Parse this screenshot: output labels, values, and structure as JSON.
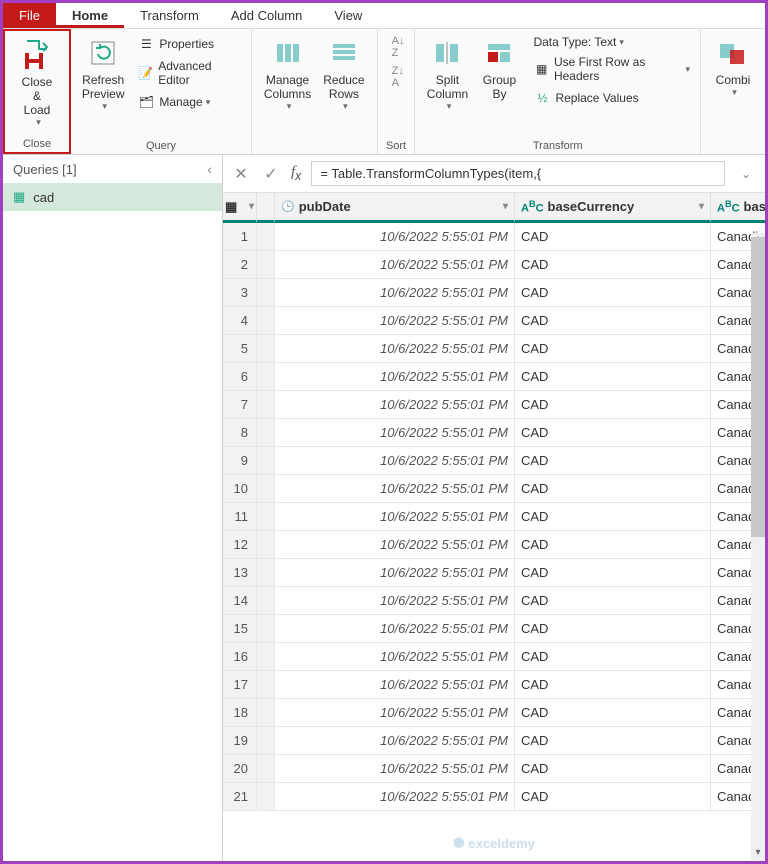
{
  "tabs": {
    "file": "File",
    "home": "Home",
    "transform": "Transform",
    "addColumn": "Add Column",
    "view": "View"
  },
  "ribbon": {
    "close": {
      "label": "Close &\nLoad",
      "group": "Close"
    },
    "refresh": {
      "label": "Refresh\nPreview",
      "group": "Query"
    },
    "query": {
      "properties": "Properties",
      "advanced": "Advanced Editor",
      "manage": "Manage"
    },
    "manageCols": {
      "label": "Manage\nColumns"
    },
    "reduceRows": {
      "label": "Reduce\nRows"
    },
    "sort": {
      "group": "Sort"
    },
    "split": {
      "label": "Split\nColumn"
    },
    "groupBy": {
      "label": "Group\nBy"
    },
    "transform": {
      "dataType": "Data Type: Text",
      "firstRow": "Use First Row as Headers",
      "replace": "Replace Values",
      "group": "Transform"
    },
    "combine": {
      "label": "Combi"
    }
  },
  "sidebar": {
    "title": "Queries [1]",
    "items": [
      "cad"
    ]
  },
  "formula": "= Table.TransformColumnTypes(item,{",
  "columns": {
    "pubDate": "pubDate",
    "baseCurrency": "baseCurrency",
    "baseName": "baseNa"
  },
  "rows": [
    {
      "n": 1,
      "date": "10/6/2022 5:55:01 PM",
      "cur": "CAD",
      "name": "Canadian"
    },
    {
      "n": 2,
      "date": "10/6/2022 5:55:01 PM",
      "cur": "CAD",
      "name": "Canadian"
    },
    {
      "n": 3,
      "date": "10/6/2022 5:55:01 PM",
      "cur": "CAD",
      "name": "Canadian"
    },
    {
      "n": 4,
      "date": "10/6/2022 5:55:01 PM",
      "cur": "CAD",
      "name": "Canadian"
    },
    {
      "n": 5,
      "date": "10/6/2022 5:55:01 PM",
      "cur": "CAD",
      "name": "Canadian"
    },
    {
      "n": 6,
      "date": "10/6/2022 5:55:01 PM",
      "cur": "CAD",
      "name": "Canadian"
    },
    {
      "n": 7,
      "date": "10/6/2022 5:55:01 PM",
      "cur": "CAD",
      "name": "Canadian"
    },
    {
      "n": 8,
      "date": "10/6/2022 5:55:01 PM",
      "cur": "CAD",
      "name": "Canadian"
    },
    {
      "n": 9,
      "date": "10/6/2022 5:55:01 PM",
      "cur": "CAD",
      "name": "Canadian"
    },
    {
      "n": 10,
      "date": "10/6/2022 5:55:01 PM",
      "cur": "CAD",
      "name": "Canadian"
    },
    {
      "n": 11,
      "date": "10/6/2022 5:55:01 PM",
      "cur": "CAD",
      "name": "Canadian"
    },
    {
      "n": 12,
      "date": "10/6/2022 5:55:01 PM",
      "cur": "CAD",
      "name": "Canadian"
    },
    {
      "n": 13,
      "date": "10/6/2022 5:55:01 PM",
      "cur": "CAD",
      "name": "Canadian"
    },
    {
      "n": 14,
      "date": "10/6/2022 5:55:01 PM",
      "cur": "CAD",
      "name": "Canadian"
    },
    {
      "n": 15,
      "date": "10/6/2022 5:55:01 PM",
      "cur": "CAD",
      "name": "Canadian"
    },
    {
      "n": 16,
      "date": "10/6/2022 5:55:01 PM",
      "cur": "CAD",
      "name": "Canadian"
    },
    {
      "n": 17,
      "date": "10/6/2022 5:55:01 PM",
      "cur": "CAD",
      "name": "Canadian"
    },
    {
      "n": 18,
      "date": "10/6/2022 5:55:01 PM",
      "cur": "CAD",
      "name": "Canadian"
    },
    {
      "n": 19,
      "date": "10/6/2022 5:55:01 PM",
      "cur": "CAD",
      "name": "Canadian"
    },
    {
      "n": 20,
      "date": "10/6/2022 5:55:01 PM",
      "cur": "CAD",
      "name": "Canadian"
    },
    {
      "n": 21,
      "date": "10/6/2022 5:55:01 PM",
      "cur": "CAD",
      "name": "Canadian"
    }
  ],
  "watermark": "exceldemy"
}
